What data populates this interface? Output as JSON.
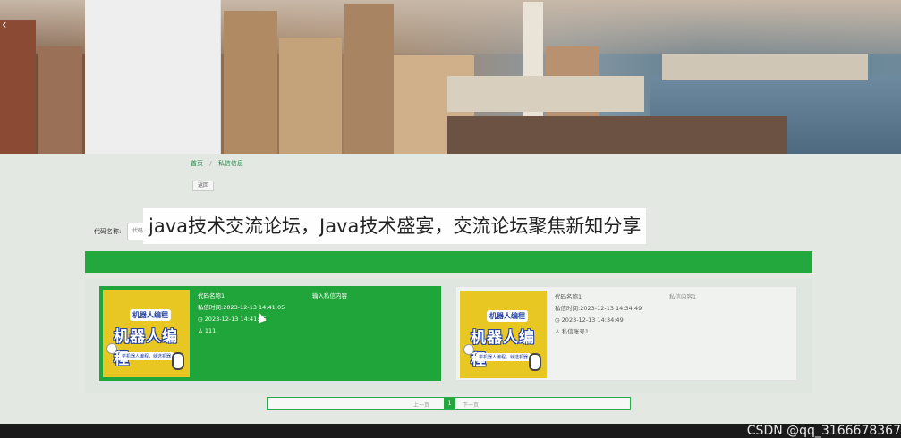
{
  "breadcrumb": {
    "home": "首页",
    "separator": "/",
    "current": "私信信息"
  },
  "back_button": "返回",
  "search": {
    "label": "代码名称:",
    "placeholder": "代码名称"
  },
  "caption": "java技术交流论坛，Java技术盛宴，交流论坛聚焦新知分享",
  "cards": [
    {
      "name": "代码名称1",
      "message_label": "输入私信内容",
      "time_line": "私信时间:2023-12-13 14:41:05",
      "clock_line": "2023-12-13 14:41:05",
      "user_line": "111",
      "image": {
        "badge": "机器人编程",
        "title": "机器人编程",
        "subtitle": "学机器人编程，就选机器"
      }
    },
    {
      "name": "代码名称1",
      "message_label": "私信内容1",
      "time_line": "私信时间:2023-12-13 14:34:49",
      "clock_line": "2023-12-13 14:34:49",
      "user_line": "私信账号1",
      "image": {
        "badge": "机器人编程",
        "title": "机器人编程",
        "subtitle": "学机器人编程，就选机器"
      }
    }
  ],
  "pager": {
    "prev": "上一页",
    "current": "1",
    "next": "下一页"
  },
  "watermark": "CSDN @qq_3166678367",
  "colors": {
    "accent": "#22a83c",
    "card_active": "#20a53a",
    "card_inactive": "#f0f2f0"
  }
}
